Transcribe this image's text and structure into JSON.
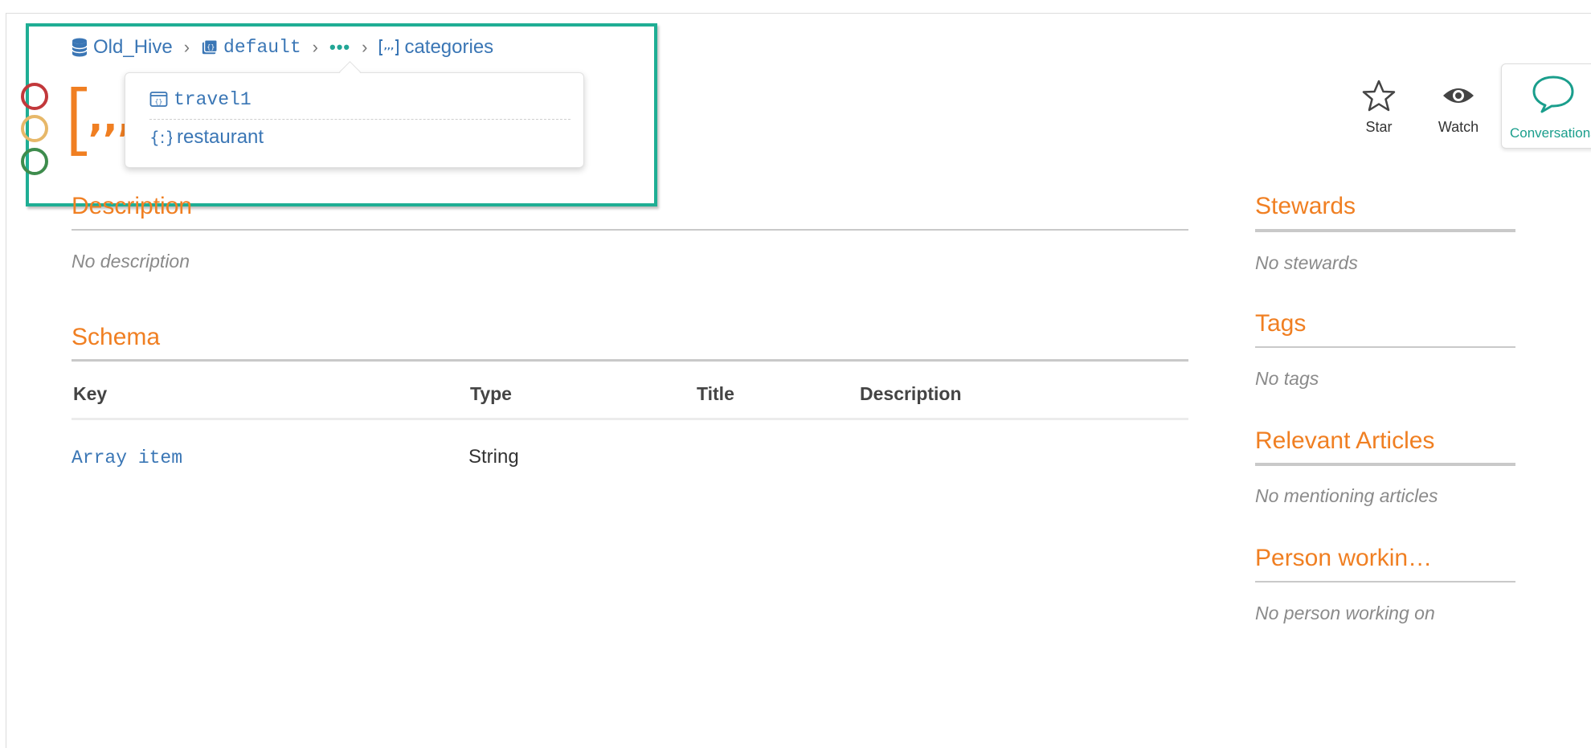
{
  "breadcrumb": {
    "database": "Old_Hive",
    "schema": "default",
    "ellipsis": "•••",
    "current": "categories",
    "separator": "›"
  },
  "popover": {
    "items": [
      {
        "label": "travel1",
        "icon": "table-icon"
      },
      {
        "label": "restaurant",
        "icon": "struct-icon"
      }
    ]
  },
  "actions": {
    "star": "Star",
    "watch": "Watch",
    "conversations": "Conversations"
  },
  "main": {
    "description": {
      "title": "Description",
      "empty": "No description"
    },
    "schema": {
      "title": "Schema",
      "columns": [
        "Key",
        "Type",
        "Title",
        "Description"
      ],
      "rows": [
        {
          "key": "Array item",
          "type": "String",
          "title": "",
          "description": ""
        }
      ]
    }
  },
  "sidebar": {
    "stewards": {
      "title": "Stewards",
      "empty": "No stewards"
    },
    "tags": {
      "title": "Tags",
      "empty": "No tags"
    },
    "articles": {
      "title": "Relevant Articles",
      "empty": "No mentioning articles"
    },
    "person": {
      "title": "Person workin…",
      "empty": "No person working on"
    }
  },
  "colors": {
    "accent": "#f07f22",
    "link": "#3a76b5",
    "teal": "#1fae94"
  }
}
